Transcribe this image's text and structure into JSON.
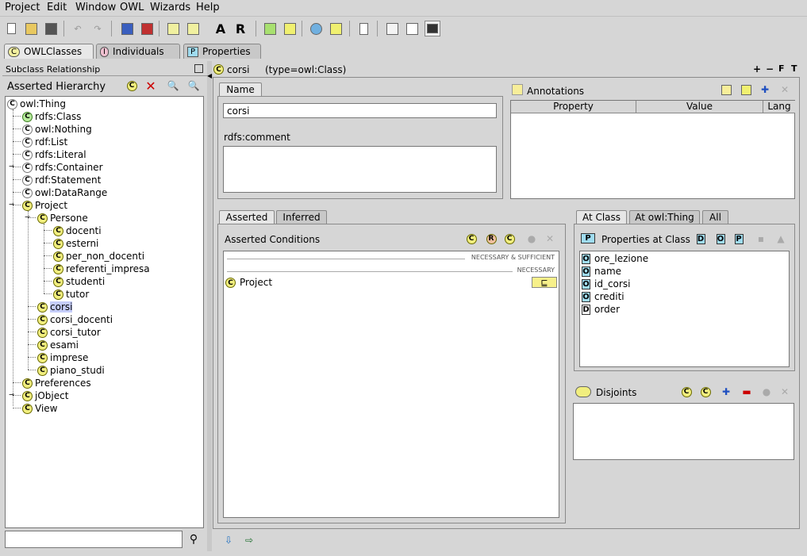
{
  "menu": [
    "Project",
    "Edit",
    "Window",
    "OWL",
    "Wizards",
    "Help"
  ],
  "toolbar": {
    "letter_a": "A",
    "letter_r": "R"
  },
  "tabs": [
    {
      "badge": "C",
      "label": "OWLClasses"
    },
    {
      "badge": "I",
      "label": "Individuals"
    },
    {
      "badge": "P",
      "label": "Properties"
    }
  ],
  "left_panel": {
    "header": "Subclass Relationship",
    "title": "Asserted Hierarchy",
    "search_value": "",
    "tree": [
      {
        "label": "owl:Thing",
        "icon": "white",
        "level": 0
      },
      {
        "label": "rdfs:Class",
        "icon": "green",
        "level": 1
      },
      {
        "label": "owl:Nothing",
        "icon": "white",
        "level": 1
      },
      {
        "label": "rdf:List",
        "icon": "white",
        "level": 1
      },
      {
        "label": "rdfs:Literal",
        "icon": "white",
        "level": 1
      },
      {
        "label": "rdfs:Container",
        "icon": "white",
        "level": 1
      },
      {
        "label": "rdf:Statement",
        "icon": "white",
        "level": 1
      },
      {
        "label": "owl:DataRange",
        "icon": "white",
        "level": 1
      },
      {
        "label": "Project",
        "icon": "yellow",
        "level": 1
      },
      {
        "label": "Persone",
        "icon": "yellow",
        "level": 2
      },
      {
        "label": "docenti",
        "icon": "yellow",
        "level": 3
      },
      {
        "label": "esterni",
        "icon": "yellow",
        "level": 3
      },
      {
        "label": "per_non_docenti",
        "icon": "yellow",
        "level": 3
      },
      {
        "label": "referenti_impresa",
        "icon": "yellow",
        "level": 3
      },
      {
        "label": "studenti",
        "icon": "yellow",
        "level": 3
      },
      {
        "label": "tutor",
        "icon": "yellow",
        "level": 3
      },
      {
        "label": "corsi",
        "icon": "yellow",
        "level": 2,
        "selected": true
      },
      {
        "label": "corsi_docenti",
        "icon": "yellow",
        "level": 2
      },
      {
        "label": "corsi_tutor",
        "icon": "yellow",
        "level": 2
      },
      {
        "label": "esami",
        "icon": "yellow",
        "level": 2
      },
      {
        "label": "imprese",
        "icon": "yellow",
        "level": 2
      },
      {
        "label": "piano_studi",
        "icon": "yellow",
        "level": 2
      },
      {
        "label": "Preferences",
        "icon": "yellow",
        "level": 1
      },
      {
        "label": "jObject",
        "icon": "yellow",
        "level": 1
      },
      {
        "label": "View",
        "icon": "yellow",
        "level": 1
      }
    ]
  },
  "class_header": {
    "name": "corsi",
    "type": "(type=owl:Class)",
    "controls": [
      "+",
      "−",
      "F",
      "T"
    ]
  },
  "name_panel": {
    "tab": "Name",
    "value": "corsi",
    "comment_label": "rdfs:comment",
    "comment_value": ""
  },
  "annotations": {
    "title": "Annotations",
    "columns": [
      "Property",
      "Value",
      "Lang"
    ]
  },
  "conditions": {
    "tabs": [
      "Asserted",
      "Inferred"
    ],
    "title": "Asserted Conditions",
    "nec_suff": "NECESSARY & SUFFICIENT",
    "necessary": "NECESSARY",
    "item": "Project",
    "item_badge": "⊑"
  },
  "properties_panel": {
    "tabs": [
      "At Class",
      "At owl:Thing",
      "All"
    ],
    "title": "Properties at Class",
    "items": [
      {
        "type": "O",
        "label": "ore_lezione"
      },
      {
        "type": "O",
        "label": "name"
      },
      {
        "type": "O",
        "label": "id_corsi"
      },
      {
        "type": "O",
        "label": "crediti"
      },
      {
        "type": "D",
        "label": "order"
      }
    ]
  },
  "disjoints": {
    "title": "Disjoints"
  }
}
